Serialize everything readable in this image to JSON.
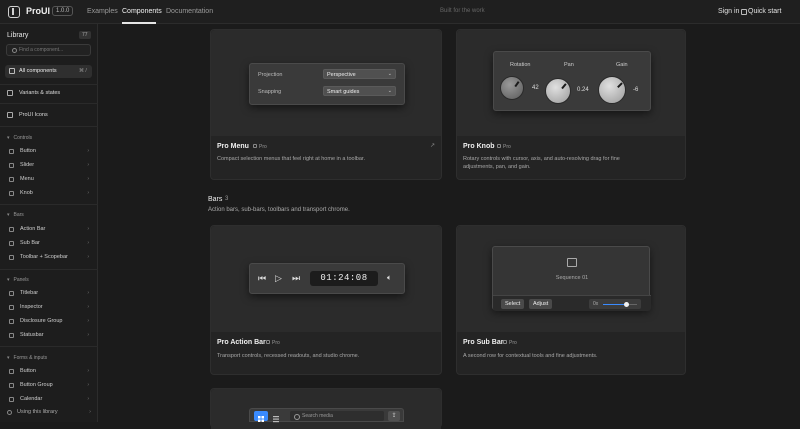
{
  "header": {
    "brand": "ProUI",
    "version": "1.0.0",
    "nav": [
      "Examples",
      "Components",
      "Documentation"
    ],
    "active_nav": "Components",
    "tagline": "Built for the work",
    "signin": "Sign in",
    "quickstart": "Quick start"
  },
  "sidebar": {
    "title": "Library",
    "count": "77",
    "search_placeholder": "Find a component...",
    "all": {
      "label": "All components",
      "kbd": "⌘ /"
    },
    "main_items": [
      "Variants & states",
      "ProUI Icons"
    ],
    "sections": [
      {
        "title": "Controls",
        "items": [
          "Button",
          "Slider",
          "Menu",
          "Knob"
        ]
      },
      {
        "title": "Bars",
        "items": [
          "Action Bar",
          "Sub Bar",
          "Toolbar + Scopebar"
        ]
      },
      {
        "title": "Panels",
        "items": [
          "Titlebar",
          "Inspector",
          "Disclosure Group",
          "Statusbar"
        ]
      },
      {
        "title": "Forms & inputs",
        "items": [
          "Button",
          "Button Group",
          "Calendar"
        ]
      }
    ],
    "footer": "Using this library"
  },
  "cards": {
    "menu": {
      "title": "Pro Menu",
      "badge": "Pro",
      "desc": "Compact selection menus that feel right at home in a toolbar.",
      "rows": [
        {
          "label": "Projection",
          "value": "Perspective"
        },
        {
          "label": "Snapping",
          "value": "Smart guides"
        }
      ]
    },
    "knob": {
      "title": "Pro Knob",
      "badge": "Pro",
      "desc": "Rotary controls with cursor, axis, and auto-resolving drag for fine adjustments, pan, and gain.",
      "knobs": [
        {
          "label": "Rotation",
          "value": "42"
        },
        {
          "label": "Pan",
          "value": "0.24"
        },
        {
          "label": "Gain",
          "value": "-6"
        }
      ]
    },
    "action": {
      "title": "Pro Action Bar",
      "badge": "Pro",
      "desc": "Transport controls, recessed readouts, and studio chrome.",
      "readout": "01:24:08"
    },
    "sub": {
      "title": "Pro Sub Bar",
      "badge": "Pro",
      "desc": "A second row for contextual tools and fine adjustments.",
      "sequence": "Sequence 01",
      "select": "Select",
      "adjust": "Adjust",
      "slider_label": "0x",
      "slider_value": 0.7
    },
    "toolbar": {
      "search_placeholder": "Search media"
    }
  },
  "bars_section": {
    "title": "Bars",
    "count": "3",
    "desc": "Action bars, sub-bars, toolbars and transport chrome."
  },
  "colors": {
    "accent": "#3a8bff",
    "background": "#1b1b1b",
    "card": "#242424"
  }
}
